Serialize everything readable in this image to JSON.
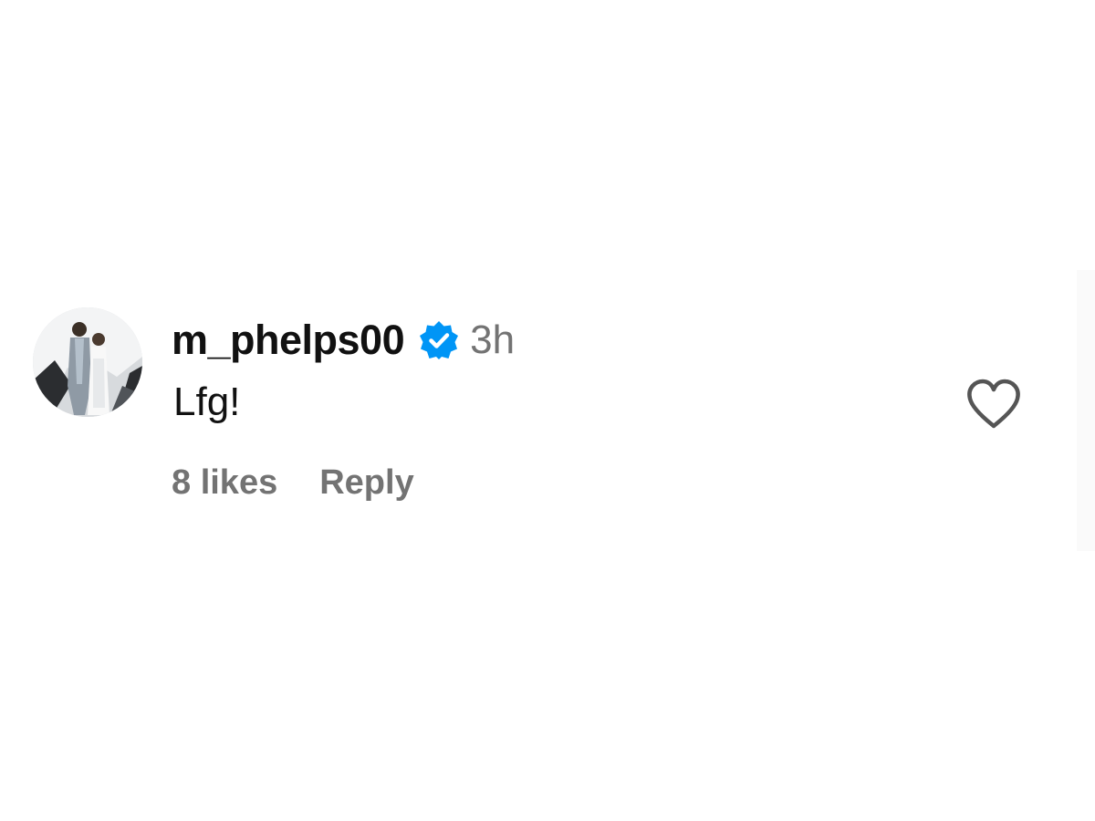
{
  "comment": {
    "username": "m_phelps00",
    "verified_icon": "verified-badge-icon",
    "timestamp": "3h",
    "text": "Lfg!",
    "likes_label": "8 likes",
    "reply_label": "Reply",
    "like_icon": "heart-outline-icon"
  },
  "colors": {
    "username": "#111111",
    "secondary_text": "#737373",
    "verified_blue": "#0095f6",
    "icon_stroke": "#555555",
    "background": "#ffffff"
  }
}
